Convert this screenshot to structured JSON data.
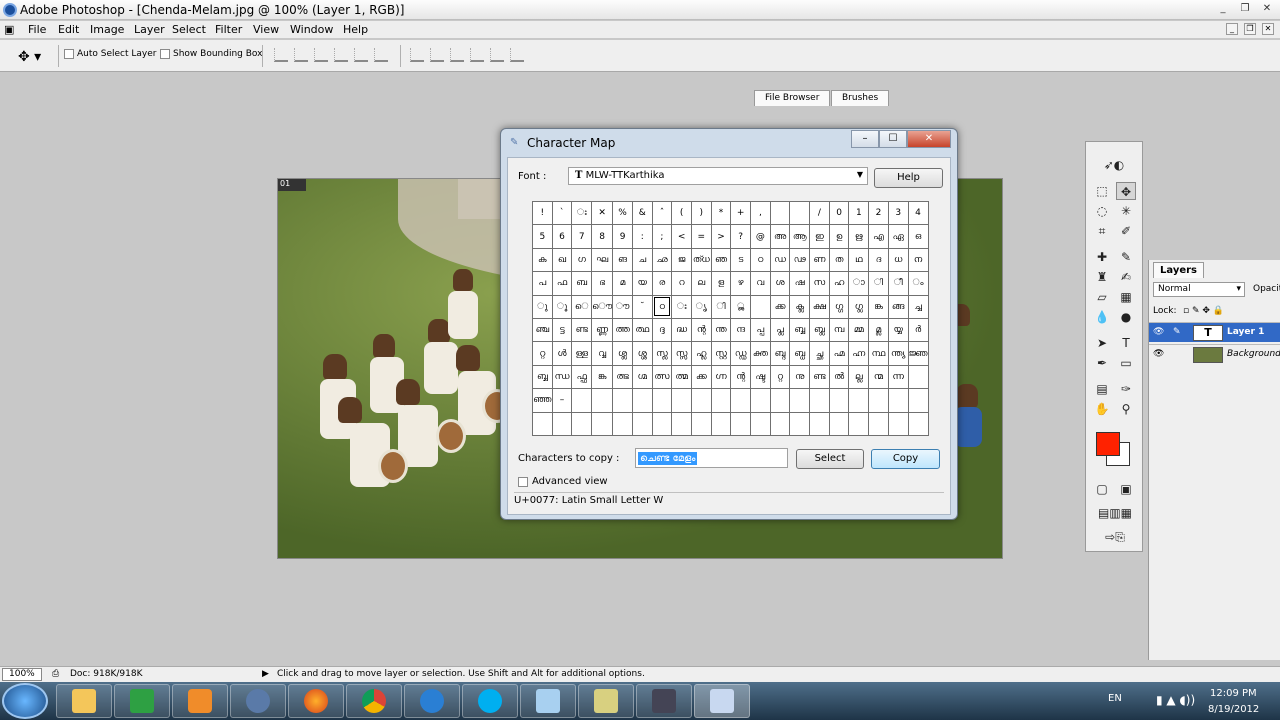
{
  "window": {
    "title": "Adobe Photoshop - [Chenda-Melam.jpg @ 100% (Layer 1, RGB)]",
    "controls": [
      "_",
      "❐",
      "✕"
    ]
  },
  "menu": [
    "File",
    "Edit",
    "Image",
    "Layer",
    "Select",
    "Filter",
    "View",
    "Window",
    "Help"
  ],
  "options": {
    "auto_select": "Auto Select Layer",
    "bounding_box": "Show Bounding Box"
  },
  "palette_well": {
    "tabs": [
      "File Browser",
      "Brushes"
    ]
  },
  "document": {
    "badge": "01"
  },
  "charmap": {
    "title": "Character Map",
    "font_label": "Font :",
    "font_value": "MLW-TTKarthika",
    "help": "Help",
    "rows": [
      [
        "!",
        "ˋ",
        "ഃ",
        "✕",
        "%",
        "&",
        "ˆ",
        "(",
        ")",
        "*",
        "+",
        ",",
        "",
        "",
        "/",
        "0",
        "1",
        "2",
        "3",
        "4"
      ],
      [
        "5",
        "6",
        "7",
        "8",
        "9",
        ":",
        ";",
        "<",
        "=",
        ">",
        "?",
        "@",
        "അ",
        "ആ",
        "ഇ",
        "ഉ",
        "ഋ",
        "എ",
        "ഏ",
        "ഒ"
      ],
      [
        "ക",
        "ഖ",
        "ഗ",
        "ഘ",
        "ങ",
        "ച",
        "ഛ",
        "ജ",
        "ത്ധ",
        "ഞ",
        "ട",
        "ഠ",
        "ഡ",
        "ഢ",
        "ണ",
        "ത",
        "ഥ",
        "ദ",
        "ധ",
        "ന"
      ],
      [
        "പ",
        "ഫ",
        "ബ",
        "ഭ",
        "മ",
        "യ",
        "ര",
        "റ",
        "ല",
        "ള",
        "ഴ",
        "വ",
        "ശ",
        "ഷ",
        "സ",
        "ഹ",
        "ാ",
        "ി",
        "ീ",
        "ം"
      ],
      [
        "ു",
        "ൂ",
        "െ",
        "ൌ",
        "ൗ",
        "˘",
        "ഠ",
        "ഃ",
        "ൃ",
        "ി",
        "ൢ",
        "",
        "ക്ക",
        "ക്ല",
        "ക്ഷ",
        "ഗ്ഗ",
        "ഗ്ല",
        "ങ്ക",
        "ങ്ങ",
        "ച്ച"
      ],
      [
        "ഞ്ച",
        "ട്ട",
        "ണ്ട",
        "ണ്ണ",
        "ത്ത",
        "ത്ഥ",
        "ദ്ദ",
        "ദ്ധ",
        "ന്റ",
        "ന്ത",
        "ന്ദ",
        "പ്പ",
        "പ്ല",
        "ബ്ബ",
        "ബ്ല",
        "മ്പ",
        "മ്മ",
        "മ്ല",
        "യ്യ",
        "ർ"
      ],
      [
        "റ്റ",
        "ൾ",
        "ള്ള",
        "വ്വ",
        "ശ്ല",
        "ശ്ശ",
        "സ്ല",
        "സ്സ",
        "ഹ്ല",
        "സ്റ്റ",
        "ഡ്ഡ",
        "ക്ത",
        "ബ്ദ",
        "ബ്ധ",
        "ച്ഛ",
        "ഹ്മ",
        "ഹ്ന",
        "ന്ഥ",
        "ന്ത്യ",
        "ജ്ഞ"
      ],
      [
        "ബ്ബ",
        "ന്ധ",
        "ഫ്ഫ",
        "ങ്ക",
        "ത്ഭ",
        "ഗ്മ",
        "ത്സ",
        "ത്മ",
        "ക്ക",
        "ഗ്ന",
        "ന്റ",
        "ഷ്ട",
        " റ്റ",
        "നു",
        "ണ്ട",
        "ൽ",
        "ല്ല",
        "ന്മ",
        "ന്ന",
        ""
      ],
      [
        "ഞ്ഞ",
        "–",
        "",
        "",
        "",
        "",
        "",
        "",
        "",
        "",
        "",
        "",
        "",
        "",
        "",
        "",
        "",
        "",
        "",
        ""
      ],
      [
        "",
        "",
        "",
        "",
        "",
        "",
        "",
        "",
        "",
        "",
        "",
        "",
        "",
        "",
        "",
        "",
        "",
        "",
        "",
        ""
      ]
    ],
    "chars_label": "Characters to copy :",
    "chars_value": "ചെണ്ട മേളം",
    "select": "Select",
    "copy": "Copy",
    "advanced": "Advanced view",
    "status": "U+0077: Latin Small Letter W"
  },
  "layers": {
    "tab": "Layers",
    "blend": "Normal",
    "opacity": "Opacit",
    "lock": "Lock:",
    "items": [
      {
        "name": "Layer 1",
        "thumb": "T"
      },
      {
        "name": "Background",
        "thumb": ""
      }
    ]
  },
  "status": {
    "zoom": "100%",
    "doc": "Doc: 918K/918K",
    "hint": "Click and drag to move layer or selection. Use Shift and Alt for additional options."
  },
  "tray": {
    "lang": "EN",
    "time": "12:09 PM",
    "date": "8/19/2012"
  }
}
